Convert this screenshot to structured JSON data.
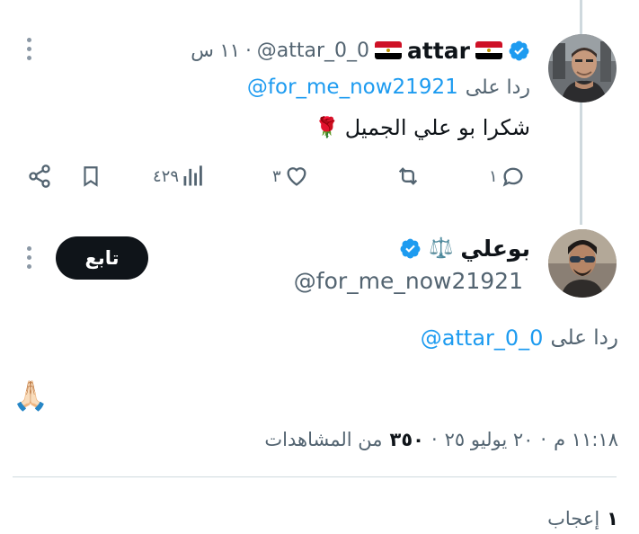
{
  "colors": {
    "accent": "#1d9bf0",
    "text": "#0f1419",
    "muted": "#536471",
    "divider": "#cfd9de",
    "follow_bg": "#0f1419"
  },
  "tweet1": {
    "display_name": "attar",
    "handle": "@attar_0_0",
    "time": "١١ س",
    "dot": "·",
    "reply_label": "ردا على",
    "reply_handle": "@for_me_now21921",
    "text": "شكرا بو علي الجميل",
    "emoji": "🌹",
    "counts": {
      "views": "٤٢٩",
      "likes": "٣",
      "replies": "١"
    }
  },
  "tweet2": {
    "display_name": "بوعلي",
    "name_emoji": "⚖️",
    "handle": "@for_me_now21921",
    "follow_label": "تابع",
    "reply_label": "ردا على",
    "reply_handle": "@attar_0_0",
    "body_emoji": "🙏🏻",
    "meta_time": "١١:١٨ م",
    "meta_dot1": "·",
    "meta_date": "٢٠ يوليو ٢٥",
    "meta_dot2": "·",
    "views_count": "٣٥٠",
    "views_label": "من المشاهدات",
    "likes_count": "١",
    "likes_label": "إعجاب"
  }
}
